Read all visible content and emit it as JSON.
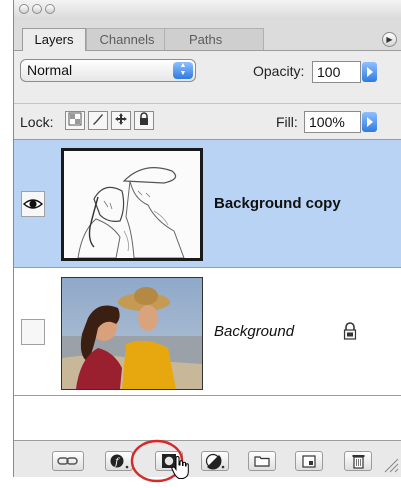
{
  "window": {
    "buttons": [
      "close",
      "minimize",
      "zoom"
    ]
  },
  "tabs": [
    {
      "label": "Layers",
      "active": true
    },
    {
      "label": "Channels",
      "active": false
    },
    {
      "label": "Paths",
      "active": false
    }
  ],
  "blend": {
    "mode": "Normal",
    "opacity_label": "Opacity:",
    "opacity_value": "100"
  },
  "lock": {
    "label": "Lock:",
    "fill_label": "Fill:",
    "fill_value": "100%",
    "icons": [
      "lock-transparent-icon",
      "lock-brush-icon",
      "lock-move-icon",
      "lock-all-icon"
    ]
  },
  "layers": [
    {
      "name": "Background copy",
      "visible": true,
      "selected": true,
      "locked": false,
      "thumbnail": "sketch-of-couple"
    },
    {
      "name": "Background",
      "visible": false,
      "selected": false,
      "locked": true,
      "thumbnail": "photo-of-couple-at-beach"
    }
  ],
  "colors": {
    "selected_row": "#b9d3f5",
    "highlight_circle": "#d42a2a",
    "accent_blue": "#2f7ae0"
  },
  "bottom_buttons": [
    "link-layers-icon",
    "layer-style-icon",
    "add-layer-mask-icon",
    "adjustment-layer-icon",
    "new-group-icon",
    "new-layer-icon",
    "trash-icon"
  ],
  "highlighted_button": "add-layer-mask-icon"
}
